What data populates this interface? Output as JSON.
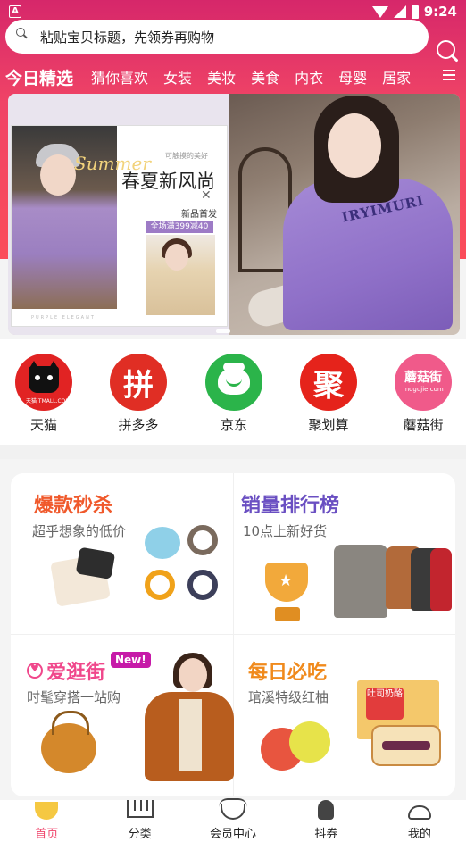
{
  "status_bar": {
    "time": "9:24",
    "left_icon": "A"
  },
  "search": {
    "placeholder": "粘贴宝贝标题，先领券再购物"
  },
  "tabs": [
    "今日精选",
    "猜你喜欢",
    "女装",
    "美妆",
    "美食",
    "内衣",
    "母婴",
    "居家"
  ],
  "banner": {
    "small_text": "可触摸的美好",
    "title": "春夏新风尚",
    "close": "✕",
    "new_label": "新品首发",
    "promo": "全场满399减40",
    "script_text": "Summer",
    "sweater_text": "IRYIMURI",
    "footer": "PURPLE ELEGANT"
  },
  "shortcuts": [
    {
      "label": "天猫",
      "icon": "tmall-cat-icon",
      "icon_text": "天猫 TMALL.COM"
    },
    {
      "label": "拼多多",
      "icon": "pinduoduo-icon",
      "icon_text": "拼"
    },
    {
      "label": "京东",
      "icon": "jd-dog-icon"
    },
    {
      "label": "聚划算",
      "icon": "juhuasuan-icon",
      "icon_text": "聚"
    },
    {
      "label": "蘑菇街",
      "icon": "mogujie-icon",
      "icon_text": "蘑菇街",
      "icon_url": "mogujie.com"
    }
  ],
  "promos": {
    "flash_sale": {
      "title": "爆款秒杀",
      "subtitle": "超乎想象的低价",
      "color": "#f0592b"
    },
    "ranking": {
      "title": "销量排行榜",
      "subtitle": "10点上新好货",
      "color": "#6a4fc2"
    },
    "street": {
      "title": "爱逛街",
      "subtitle": "时髦穿搭一站购",
      "badge": "New!",
      "color": "#f0478b"
    },
    "daily": {
      "title": "每日必吃",
      "subtitle": "琯溪特级红柚",
      "color": "#f08a1c",
      "product_label": "吐司奶酪"
    }
  },
  "navbar": [
    {
      "label": "首页",
      "icon": "home-icon",
      "active": true
    },
    {
      "label": "分类",
      "icon": "category-icon",
      "active": false
    },
    {
      "label": "会员中心",
      "icon": "vip-center-icon",
      "active": false
    },
    {
      "label": "抖券",
      "icon": "douyin-coupon-icon",
      "active": false
    },
    {
      "label": "我的",
      "icon": "profile-icon",
      "active": false
    }
  ],
  "colors": {
    "header_top": "#d6276a",
    "header_bottom": "#fb4c5a",
    "active_nav": "#f0476e"
  }
}
